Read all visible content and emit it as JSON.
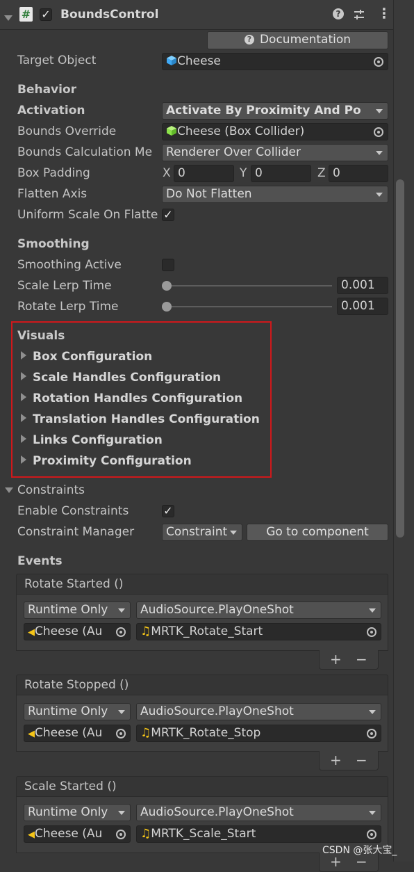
{
  "component": {
    "title": "BoundsControl",
    "enabled": true,
    "documentation_label": "Documentation"
  },
  "target_object": {
    "label": "Target Object",
    "value": "Cheese"
  },
  "behavior": {
    "header": "Behavior",
    "activation_label": "Activation",
    "activation_value": "Activate By Proximity And Po",
    "bounds_override_label": "Bounds Override",
    "bounds_override_value": "Cheese (Box Collider)",
    "bounds_calc_label": "Bounds Calculation Me",
    "bounds_calc_value": "Renderer Over Collider",
    "box_padding_label": "Box Padding",
    "box_padding": {
      "x_label": "X",
      "x": "0",
      "y_label": "Y",
      "y": "0",
      "z_label": "Z",
      "z": "0"
    },
    "flatten_axis_label": "Flatten Axis",
    "flatten_axis_value": "Do Not Flatten",
    "uniform_scale_label": "Uniform Scale On Flatte",
    "uniform_scale_checked": true
  },
  "smoothing": {
    "header": "Smoothing",
    "active_label": "Smoothing Active",
    "active_checked": false,
    "scale_lerp_label": "Scale Lerp Time",
    "scale_lerp_value": "0.001",
    "rotate_lerp_label": "Rotate Lerp Time",
    "rotate_lerp_value": "0.001"
  },
  "visuals": {
    "header": "Visuals",
    "highlight_color": "#d0181b",
    "items": [
      "Box Configuration",
      "Scale Handles Configuration",
      "Rotation Handles Configuration",
      "Translation Handles Configuration",
      "Links Configuration",
      "Proximity Configuration"
    ]
  },
  "constraints": {
    "header": "Constraints",
    "enable_label": "Enable Constraints",
    "enable_checked": true,
    "manager_label": "Constraint Manager",
    "manager_value": "Constraint",
    "goto_label": "Go to component"
  },
  "events": {
    "header": "Events",
    "list": [
      {
        "name": "Rotate Started ()",
        "mode": "Runtime Only",
        "function": "AudioSource.PlayOneShot",
        "object": "Cheese (Au",
        "argument": "MRTK_Rotate_Start"
      },
      {
        "name": "Rotate Stopped ()",
        "mode": "Runtime Only",
        "function": "AudioSource.PlayOneShot",
        "object": "Cheese (Au",
        "argument": "MRTK_Rotate_Stop"
      },
      {
        "name": "Scale Started ()",
        "mode": "Runtime Only",
        "function": "AudioSource.PlayOneShot",
        "object": "Cheese (Au",
        "argument": "MRTK_Scale_Start"
      }
    ],
    "plus": "+",
    "minus": "−"
  },
  "watermark": "CSDN @张大宝_",
  "colors": {
    "background": "#383838",
    "field": "#2a2a2a",
    "dropdown": "#515151",
    "cube_blue": "#3fa9f5",
    "cube_green": "#8ce34a",
    "audio_yellow": "#f5c518"
  }
}
